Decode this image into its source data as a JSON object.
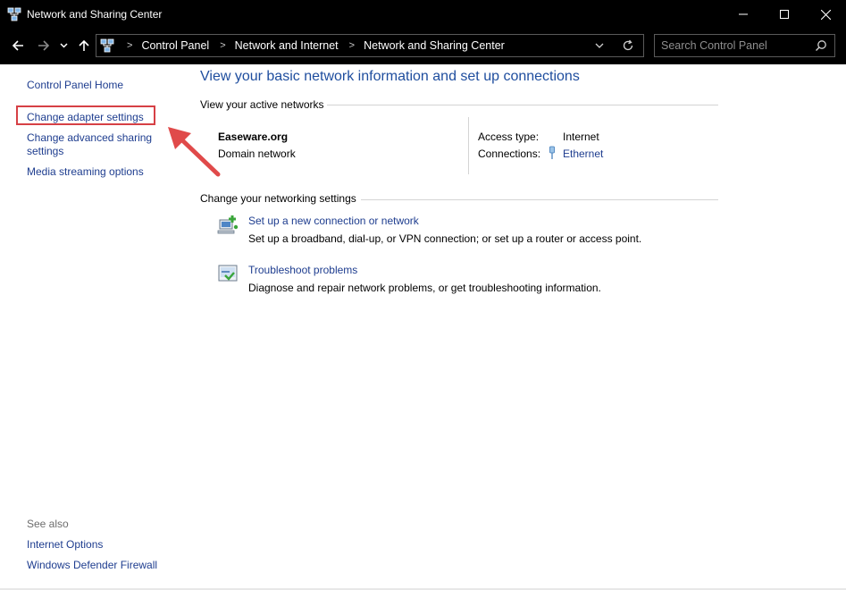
{
  "window": {
    "title": "Network and Sharing Center"
  },
  "address": {
    "crumbs": [
      "Control Panel",
      "Network and Internet",
      "Network and Sharing Center"
    ],
    "search_placeholder": "Search Control Panel"
  },
  "sidebar": {
    "home": "Control Panel Home",
    "items": [
      {
        "label": "Change adapter settings"
      },
      {
        "label_line1": "Change advanced sharing",
        "label_line2": "settings"
      },
      {
        "label": "Media streaming options"
      }
    ],
    "see_also": {
      "label": "See also",
      "links": [
        "Internet Options",
        "Windows Defender Firewall"
      ]
    }
  },
  "main": {
    "heading": "View your basic network information and set up connections",
    "active_label": "View your active networks",
    "network": {
      "name": "Easeware.org",
      "type": "Domain network",
      "access_label": "Access type:",
      "access_value": "Internet",
      "connections_label": "Connections:",
      "connections_value": "Ethernet"
    },
    "settings_label": "Change your networking settings",
    "tasks": [
      {
        "link": "Set up a new connection or network",
        "desc": "Set up a broadband, dial-up, or VPN connection; or set up a router or access point.",
        "icon": "new-connection-icon"
      },
      {
        "link": "Troubleshoot problems",
        "desc": "Diagnose and repair network problems, or get troubleshooting information.",
        "icon": "troubleshoot-icon"
      }
    ]
  },
  "colors": {
    "link": "#1e3d8f",
    "heading": "#1e4d9e",
    "highlight": "#d64045",
    "titlebar": "#000000"
  }
}
